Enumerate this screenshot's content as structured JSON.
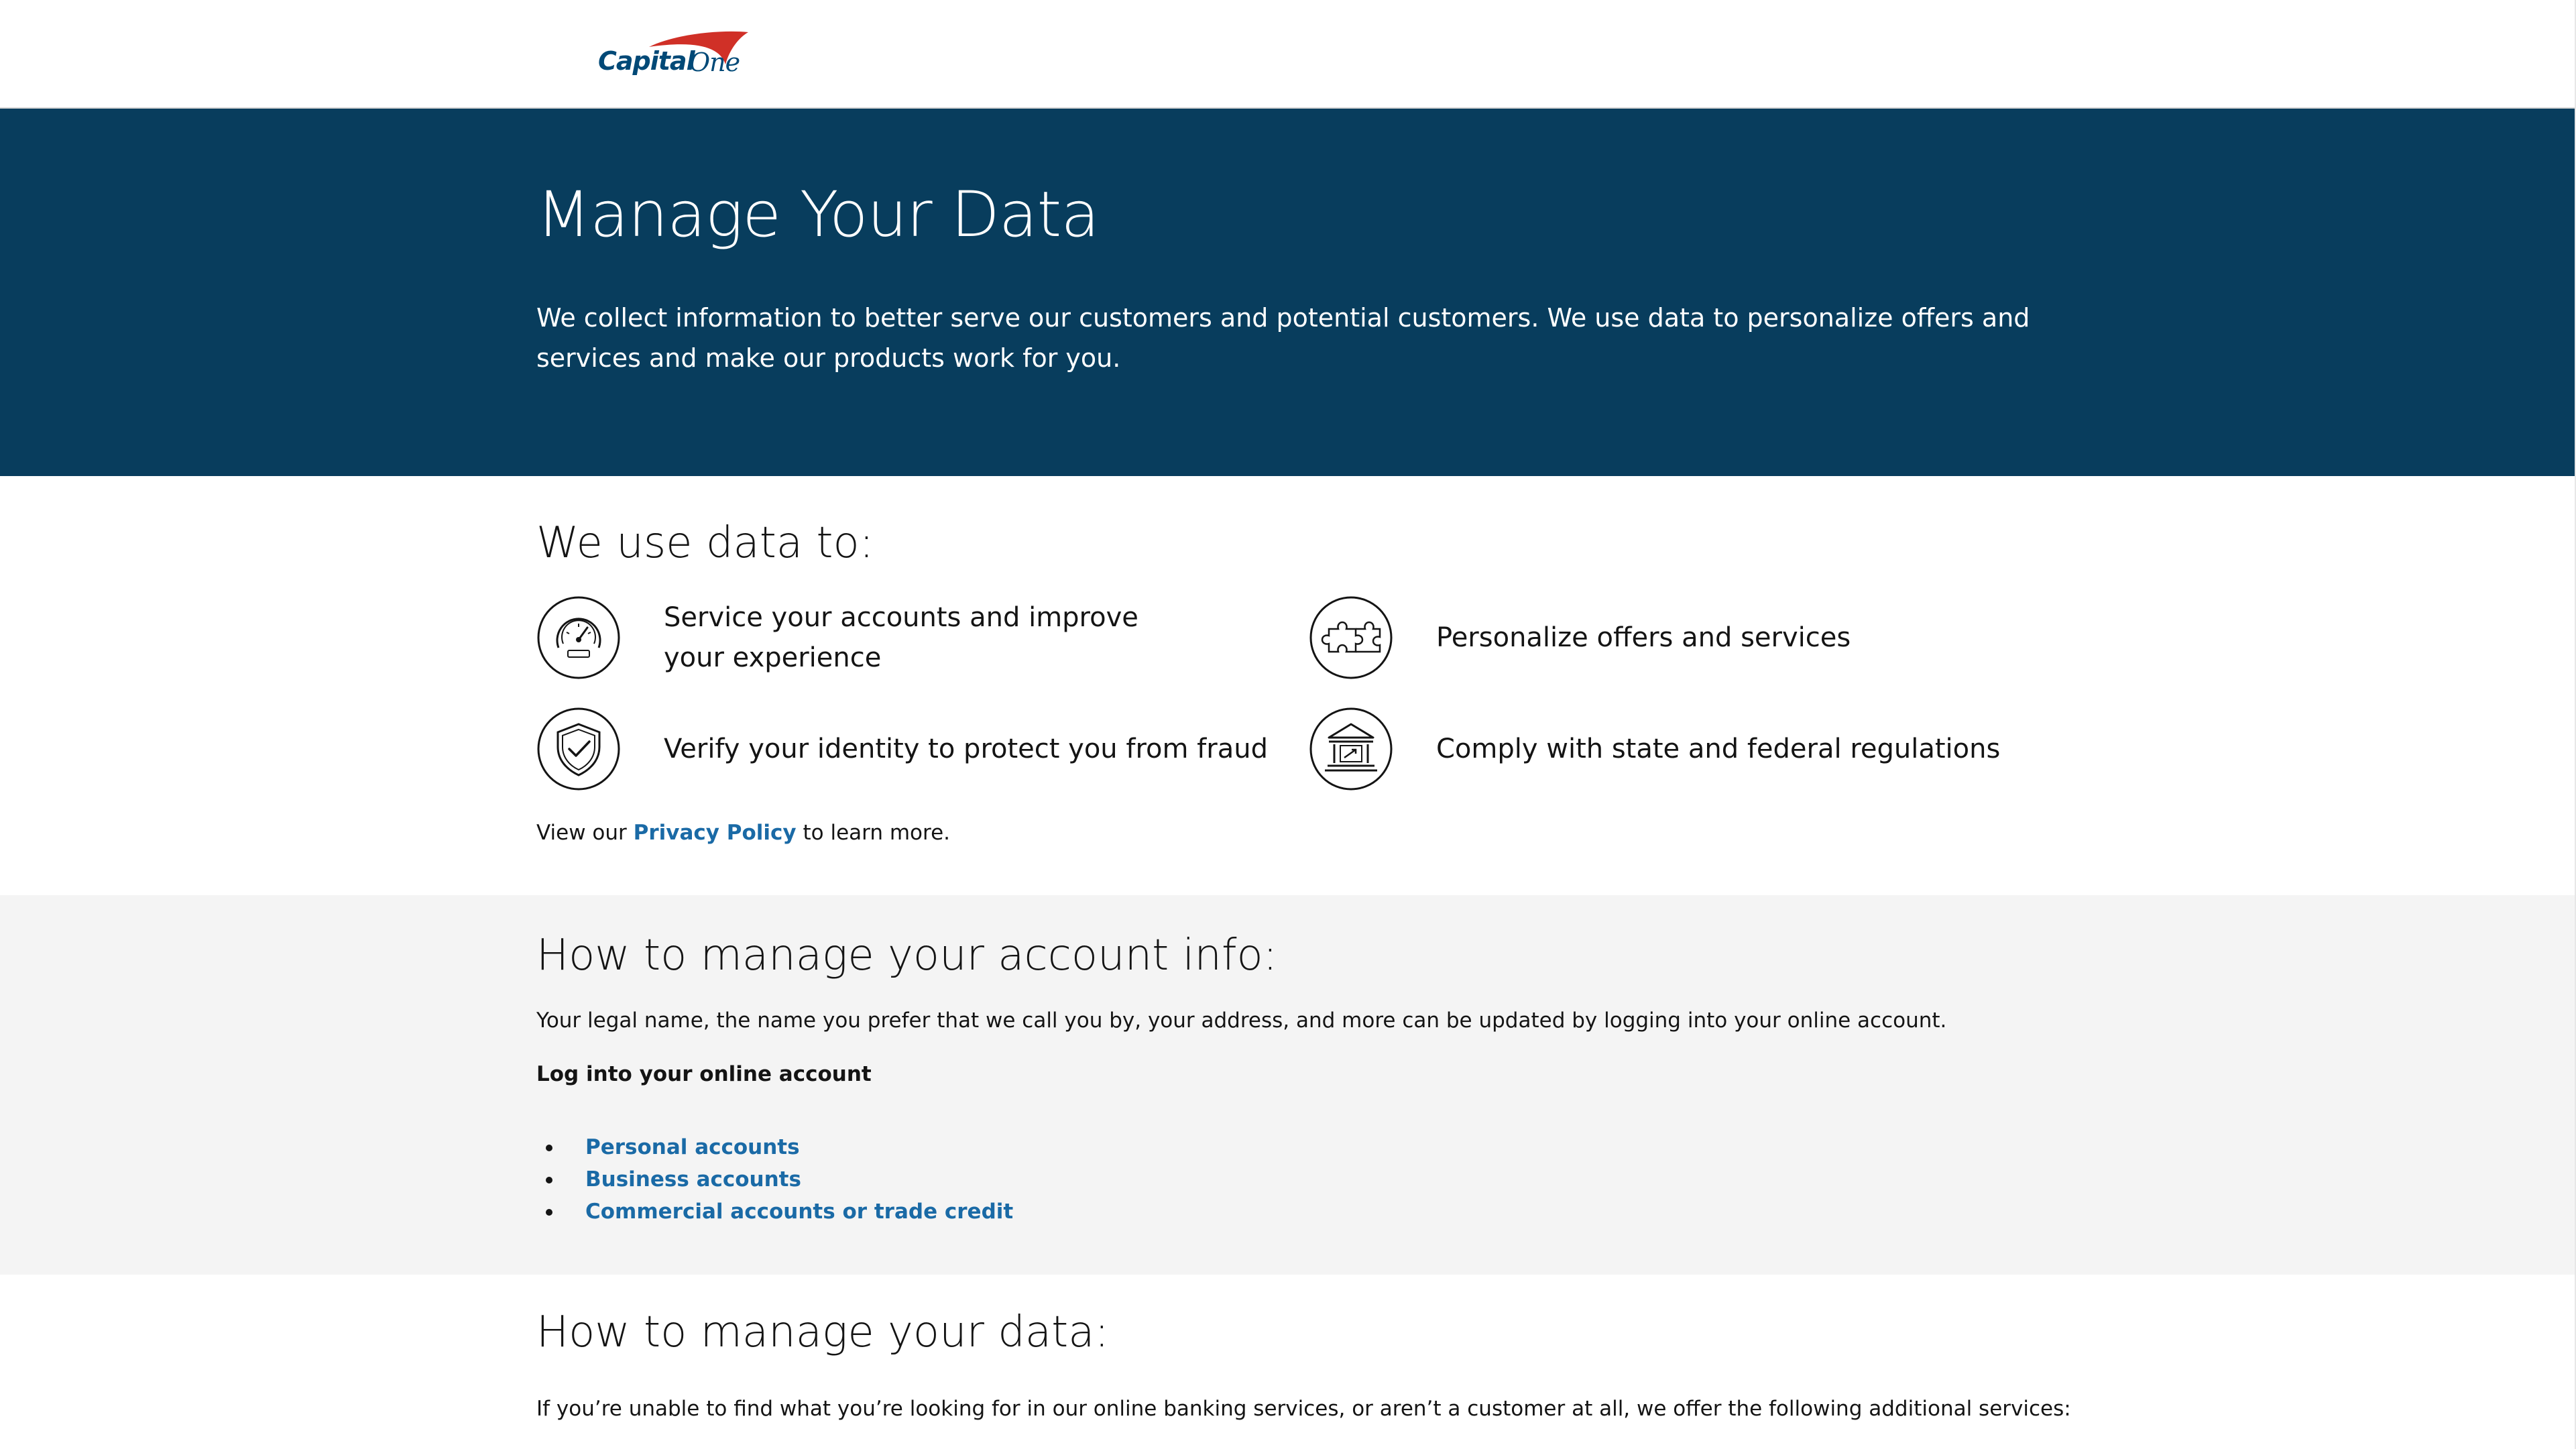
{
  "header": {
    "logo_text": "Capital One"
  },
  "hero": {
    "title": "Manage Your Data",
    "description": "We collect information to better serve our customers and potential customers. We use data to personalize offers and services and make our products work for you."
  },
  "uses": {
    "title": "We use data to:",
    "items": [
      {
        "icon": "speedometer-icon",
        "label": "Service your accounts and improve your experience"
      },
      {
        "icon": "puzzle-piece-icon",
        "label": "Personalize offers and services"
      },
      {
        "icon": "shield-check-icon",
        "label": "Verify your identity to protect you from fraud"
      },
      {
        "icon": "bank-building-icon",
        "label": "Comply with state and federal regulations"
      }
    ],
    "privacy_prefix": "View our ",
    "privacy_link": "Privacy Policy",
    "privacy_suffix": " to learn more."
  },
  "account": {
    "title": "How to manage your account info:",
    "description": "Your legal name, the name you prefer that we call you by, your address, and more can be updated by logging into your online account.",
    "login_label": "Log into your online account",
    "links": [
      "Personal accounts",
      "Business accounts",
      "Commercial accounts or trade credit"
    ]
  },
  "data_section": {
    "title": "How to manage your data:",
    "description": "If you’re unable to find what you’re looking for in our online banking services, or aren’t a customer at all, we offer the following additional services:"
  },
  "colors": {
    "hero_bg": "#083d5d",
    "link": "#1a6aa6",
    "brand_red": "#d03027",
    "brand_navy": "#004977",
    "gray_section": "#f4f4f4"
  }
}
